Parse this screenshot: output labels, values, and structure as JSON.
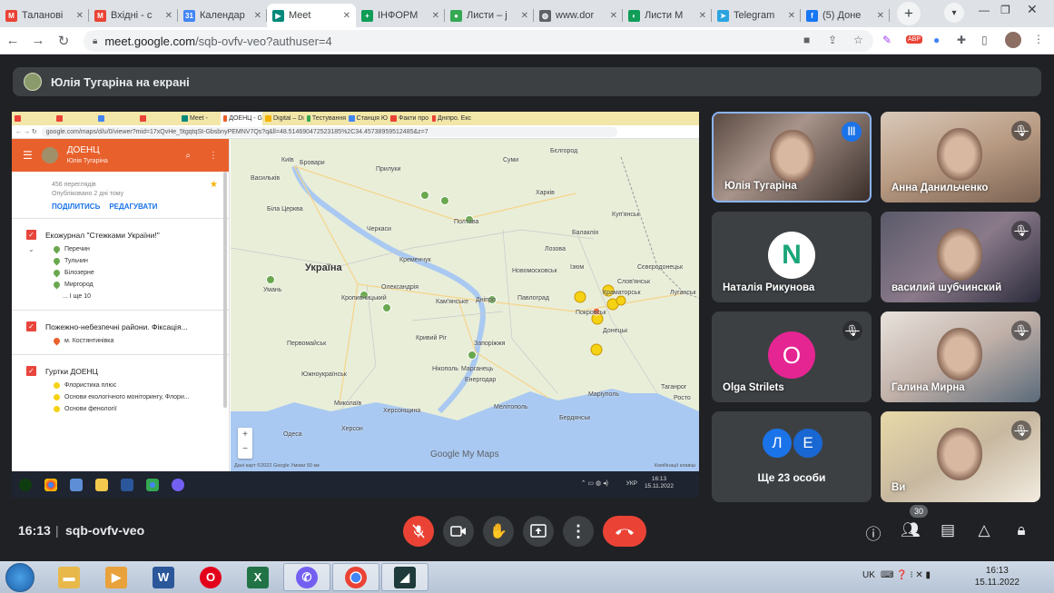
{
  "browser": {
    "tabs": [
      {
        "title": "Таланові",
        "fav": "M",
        "color": "#ea4335"
      },
      {
        "title": "Вхідні - c",
        "fav": "M",
        "color": "#ea4335"
      },
      {
        "title": "Календар",
        "fav": "31",
        "color": "#4285f4"
      },
      {
        "title": "Meet",
        "fav": "▶",
        "color": "#00897b",
        "active": true
      },
      {
        "title": "ІНФОРМ",
        "fav": "+",
        "color": "#0f9d58"
      },
      {
        "title": "Листи – ј",
        "fav": "●",
        "color": "#34a853"
      },
      {
        "title": "www.dor",
        "fav": "◍",
        "color": "#5f6368"
      },
      {
        "title": "Листи М",
        "fav": "◐",
        "color": "#0f9d58"
      },
      {
        "title": "Telegram",
        "fav": "➤",
        "color": "#2aa3df"
      },
      {
        "title": "(5) Доне",
        "fav": "f",
        "color": "#1877f2"
      }
    ],
    "url_host": "meet.google.com",
    "url_path": "/sqb-ovfv-veo?authuser=4"
  },
  "presentation": {
    "label": "Юлія Тугаріна на екрані"
  },
  "shared": {
    "tabs": [
      "",
      "",
      "",
      "",
      "Meet -",
      "ДОЕНЦ - G",
      "Digital – Di",
      "Тестування",
      "Станція Ю",
      "Факти про",
      "Дніпро. Екс"
    ],
    "url": "google.com/maps/d/u/0/viewer?mid=17xQvHe_5tgqtqSt-GbsbnyPEMNV7Qs?q&ll=48.514690472523185%2C34.45738959512485&z=7",
    "panel": {
      "title": "ДОЕНЦ",
      "author": "Юлія Тугаріна",
      "views": "456 переглядів",
      "published": "Опубліковано 2 дні тому",
      "share": "ПОДІЛИТИСЬ",
      "edit": "РЕДАГУВАТИ",
      "layer1": "Екожурнал \"Стежками України!\"",
      "items1": [
        "Перечин",
        "Тульчин",
        "Білозерне",
        "Миргород"
      ],
      "more1": "... І ще 10",
      "layer2": "Пожежно-небезпечні райони. Фіксація...",
      "items2": [
        "м. Костянтинівка"
      ],
      "layer3": "Гуртки ДОЕНЦ",
      "items3": [
        "Флористика плюс",
        "Основи екологічного моніторингу, Флори...",
        "Основи фенології"
      ]
    },
    "map_labels": {
      "ukraine": "Україна",
      "kyiv": "Київ",
      "brovary": "Бровари",
      "poltava": "Полтава",
      "kharkiv": "Харків",
      "dnipro": "Дніпро",
      "zaporizhzhia": "Запоріжжя",
      "kryvyi_rih": "Кривий Ріг",
      "mykolaiv": "Миколаїв",
      "odesa": "Одеса",
      "kherson": "Херсон",
      "mariupol": "Маріуполь",
      "donetsk": "Донецьк",
      "luhansk": "Луганськ",
      "sloviansk": "Слов'янськ",
      "kropyvnytskyi": "Кропивницький",
      "uman": "Умань",
      "kremenchuk": "Кременчук",
      "pavlohrad": "Павлоград",
      "nikopol": "Нікополь",
      "berdiansk": "Бердянськ",
      "melitopol": "Мелітополь",
      "bilhorod": "Бєлгород",
      "kamianske": "Кам'янське",
      "oleksandriia": "Олександрія",
      "sumy": "Суми",
      "rostov": "Росто",
      "taganrog": "Таганрог",
      "izium": "Ізюм",
      "bila_tserkva": "Біла Церква",
      "cherkasy": "Черкаси",
      "kramatorsk": "Краматорськ",
      "lozova": "Лозова",
      "marhanets": "Марганець",
      "pervomaisk": "Первомайськ",
      "kherson_region": "Херсонщина",
      "enerhodar": "Енергодар",
      "vasylkiv": "Васильків",
      "pokrovsk": "Покровськ",
      "pryluky": "Прилуки",
      "balakliia": "Балаклія",
      "novomoskovsk": "Новомосковськ",
      "yuzhnoukrainsk": "Южноукраїнськ",
      "kupiansk": "Куп'янськ",
      "sievierodonetsk": "Сєвєродонецьк"
    },
    "map_footer": "Дані карт ©2022 Google   Умови   50 км",
    "map_footer2": "Комбінації клавіш",
    "gmaps_logo": "Google My Maps",
    "task_lang": "УКР",
    "task_time": "16:13",
    "task_date": "15.11.2022"
  },
  "participants": [
    {
      "name": "Юлія Тугаріна",
      "type": "video",
      "speaking": true
    },
    {
      "name": "Анна Данильченко",
      "type": "video",
      "muted": true
    },
    {
      "name": "Наталія Рикунова",
      "type": "avatar"
    },
    {
      "name": "василий шубчинский",
      "type": "video",
      "muted": true
    },
    {
      "name": "Olga Strilets",
      "type": "letter",
      "letter": "O",
      "muted": true
    },
    {
      "name": "Галина Мирна",
      "type": "video",
      "muted": true
    },
    {
      "name": "Ще 23 особи",
      "type": "more",
      "letters": [
        "Л",
        "Е"
      ]
    },
    {
      "name": "Ви",
      "type": "video",
      "muted": true
    }
  ],
  "controls": {
    "time": "16:13",
    "separator": "|",
    "meeting_code": "sqb-ovfv-veo",
    "people_count": "30"
  },
  "windows": {
    "lang": "UK",
    "time": "16:13",
    "date": "15.11.2022"
  },
  "colors": {
    "meet_bg": "#202124",
    "tile_bg": "#3c4043",
    "end_call": "#ea4335",
    "accent": "#8ab4f8",
    "map_header": "#e8602c"
  },
  "icons": [
    "mic-off-icon",
    "camera-icon",
    "hand-icon",
    "present-icon",
    "more-icon",
    "end-call-icon",
    "info-icon",
    "people-icon",
    "chat-icon",
    "activities-icon",
    "lock-icon"
  ]
}
